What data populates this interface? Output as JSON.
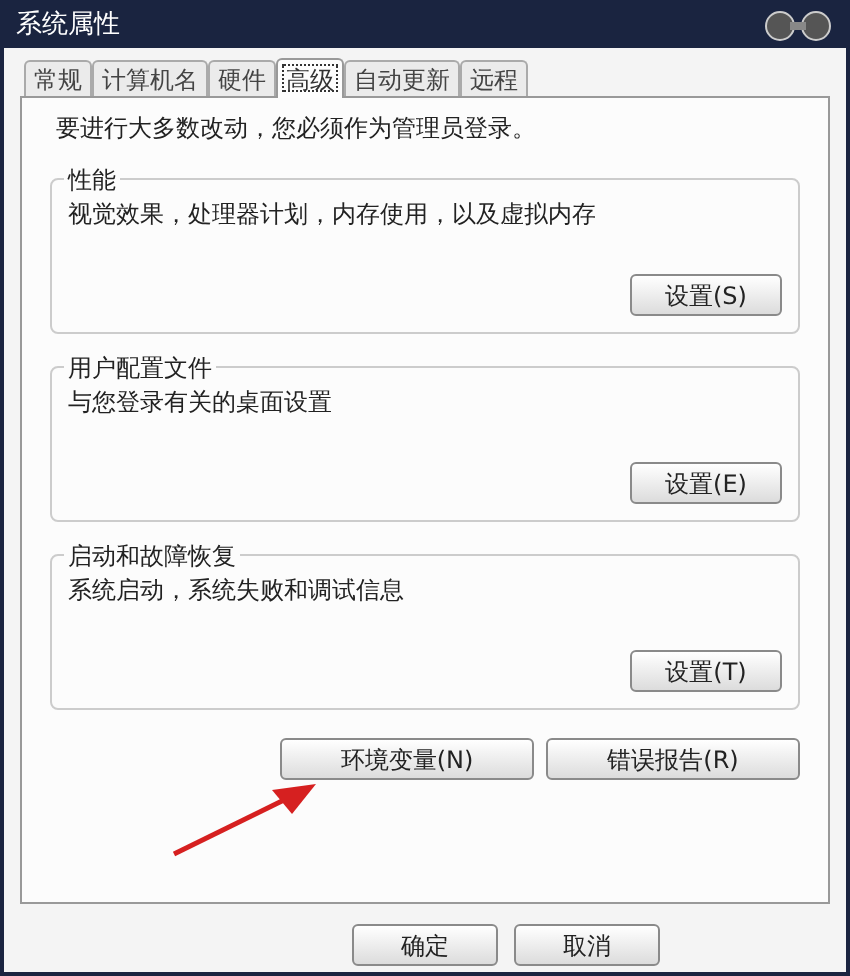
{
  "window": {
    "title": "系统属性"
  },
  "tabs": [
    {
      "label": "常规",
      "selected": false
    },
    {
      "label": "计算机名",
      "selected": false
    },
    {
      "label": "硬件",
      "selected": false
    },
    {
      "label": "高级",
      "selected": true
    },
    {
      "label": "自动更新",
      "selected": false
    },
    {
      "label": "远程",
      "selected": false
    }
  ],
  "notice": "要进行大多数改动，您必须作为管理员登录。",
  "groups": [
    {
      "title": "性能",
      "description": "视觉效果，处理器计划，内存使用，以及虚拟内存",
      "button": "设置(S)"
    },
    {
      "title": "用户配置文件",
      "description": "与您登录有关的桌面设置",
      "button": "设置(E)"
    },
    {
      "title": "启动和故障恢复",
      "description": "系统启动，系统失败和调试信息",
      "button": "设置(T)"
    }
  ],
  "panel_buttons": [
    "环境变量(N)",
    "错误报告(R)"
  ],
  "dialog_buttons": [
    "确定",
    "取消"
  ]
}
